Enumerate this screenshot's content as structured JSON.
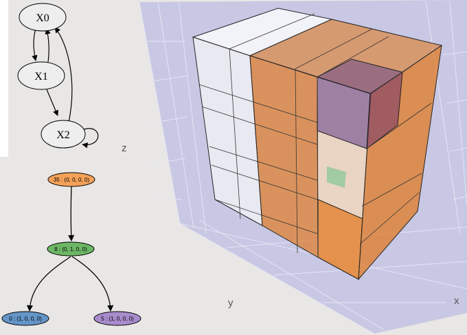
{
  "state_graph": {
    "nodes": [
      {
        "label": "X0"
      },
      {
        "label": "X1"
      },
      {
        "label": "X2"
      }
    ]
  },
  "tree": {
    "nodes": [
      {
        "label": "35 : (0, 0, 0, 0)",
        "color": "#f4a259"
      },
      {
        "label": "8 : (0, 1, 0, 0)",
        "color": "#6db665"
      },
      {
        "label": "0 : (1, 0, 0, 0)",
        "color": "#6495c8"
      },
      {
        "label": "5 : (1, 0, 0, 0)",
        "color": "#a78bcb"
      }
    ]
  },
  "plot3d": {
    "axes": {
      "x": "x",
      "y": "y",
      "z": "z"
    },
    "colors": {
      "background": "#c8c8e4",
      "orange": "#e07b24",
      "purple": "#6a4a8c",
      "green": "#8fc89a"
    }
  }
}
